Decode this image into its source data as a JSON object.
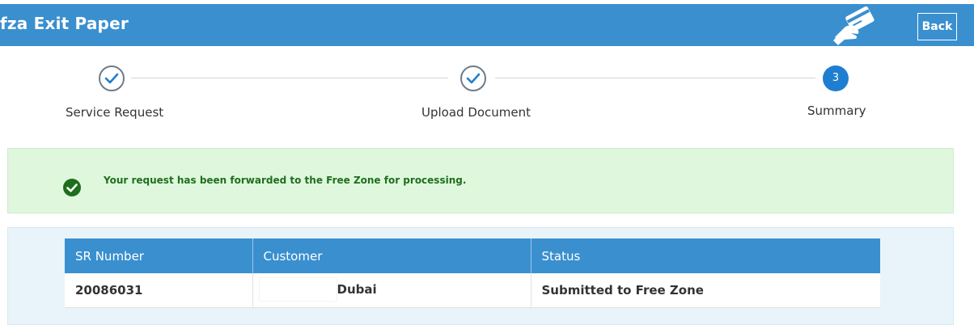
{
  "header": {
    "title": "fza Exit Paper",
    "back_label": "Back",
    "background": "#3a8fcf",
    "card_icon": "hand-card-icon"
  },
  "stepper": {
    "steps": [
      {
        "label": "Service Request",
        "state": "completed",
        "icon": "check-icon"
      },
      {
        "label": "Upload Document",
        "state": "completed",
        "icon": "check-icon"
      },
      {
        "label": "Summary",
        "state": "active",
        "number": "3"
      }
    ],
    "active_color": "#1e7fd0"
  },
  "alert": {
    "message": "Your request has been forwarded to the Free Zone for processing.",
    "icon": "check-circle-icon",
    "background": "#dff7dd",
    "text_color": "#1e6f1e"
  },
  "summary_table": {
    "headers": [
      "SR Number",
      "Customer",
      "Status"
    ],
    "rows": [
      {
        "sr_number": "20086031",
        "customer": "Dubai",
        "status": "Submitted to Free Zone"
      }
    ]
  }
}
